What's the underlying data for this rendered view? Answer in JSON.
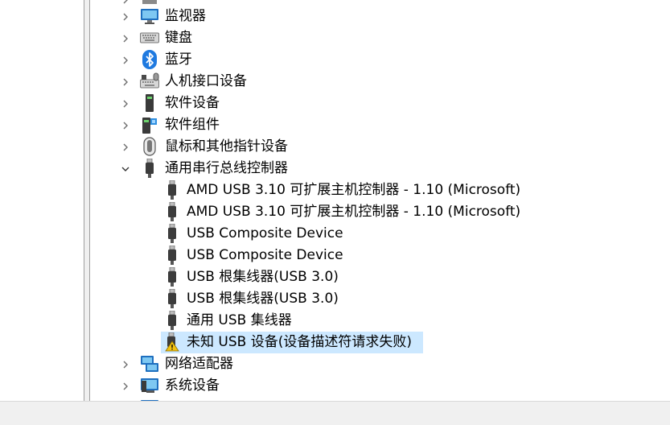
{
  "tree": {
    "rows": [
      {
        "label": "",
        "icon": "printer-icon",
        "type": "category",
        "expanded": false
      },
      {
        "label": "监视器",
        "icon": "monitor-icon",
        "type": "category",
        "expanded": false
      },
      {
        "label": "键盘",
        "icon": "keyboard-icon",
        "type": "category",
        "expanded": false
      },
      {
        "label": "蓝牙",
        "icon": "bluetooth-icon",
        "type": "category",
        "expanded": false
      },
      {
        "label": "人机接口设备",
        "icon": "hid-icon",
        "type": "category",
        "expanded": false
      },
      {
        "label": "软件设备",
        "icon": "software-device-icon",
        "type": "category",
        "expanded": false
      },
      {
        "label": "软件组件",
        "icon": "software-component-icon",
        "type": "category",
        "expanded": false
      },
      {
        "label": "鼠标和其他指针设备",
        "icon": "mouse-icon",
        "type": "category",
        "expanded": false
      },
      {
        "label": "通用串行总线控制器",
        "icon": "usb-controller-icon",
        "type": "category",
        "expanded": true
      },
      {
        "label": "AMD USB 3.10 可扩展主机控制器 - 1.10 (Microsoft)",
        "icon": "usb-plug-icon",
        "type": "child"
      },
      {
        "label": "AMD USB 3.10 可扩展主机控制器 - 1.10 (Microsoft)",
        "icon": "usb-plug-icon",
        "type": "child"
      },
      {
        "label": "USB Composite Device",
        "icon": "usb-plug-icon",
        "type": "child"
      },
      {
        "label": "USB Composite Device",
        "icon": "usb-plug-icon",
        "type": "child"
      },
      {
        "label": "USB 根集线器(USB 3.0)",
        "icon": "usb-plug-icon",
        "type": "child"
      },
      {
        "label": "USB 根集线器(USB 3.0)",
        "icon": "usb-plug-icon",
        "type": "child"
      },
      {
        "label": "通用 USB 集线器",
        "icon": "usb-plug-icon",
        "type": "child"
      },
      {
        "label": "未知 USB 设备(设备描述符请求失败)",
        "icon": "usb-warning-icon",
        "type": "child",
        "selected": true
      },
      {
        "label": "网络适配器",
        "icon": "network-adapter-icon",
        "type": "category",
        "expanded": false
      },
      {
        "label": "系统设备",
        "icon": "system-devices-icon",
        "type": "category",
        "expanded": false
      },
      {
        "label": "",
        "icon": "display-adapter-icon",
        "type": "category",
        "expanded": false
      }
    ]
  },
  "colors": {
    "selection": "#cce8ff",
    "statusbar": "#f0f0f0"
  }
}
